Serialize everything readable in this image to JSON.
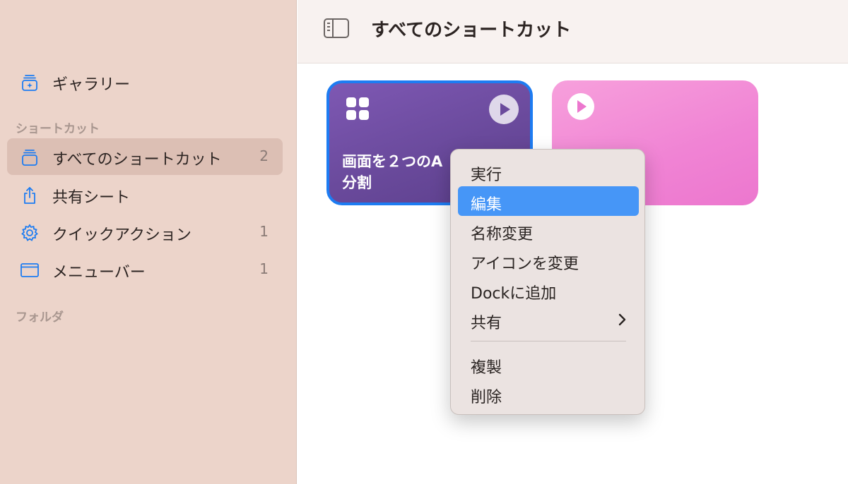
{
  "sidebar": {
    "gallery_label": "ギャラリー",
    "section_shortcuts": "ショートカット",
    "items": [
      {
        "label": "すべてのショートカット",
        "count": "2",
        "icon": "stack-icon"
      },
      {
        "label": "共有シート",
        "count": "",
        "icon": "share-icon"
      },
      {
        "label": "クイックアクション",
        "count": "1",
        "icon": "gear-icon"
      },
      {
        "label": "メニューバー",
        "count": "1",
        "icon": "window-icon"
      }
    ],
    "section_folders": "フォルダ"
  },
  "header": {
    "title": "すべてのショートカット",
    "toggle_icon": "sidebar-toggle-icon"
  },
  "cards": [
    {
      "title": "画面を２つのA\n分割",
      "color": "#6a4a9c",
      "selected": true
    },
    {
      "title": "",
      "color": "#f083d4",
      "selected": false
    }
  ],
  "context_menu": {
    "items": [
      {
        "label": "実行"
      },
      {
        "label": "編集"
      },
      {
        "label": "名称変更"
      },
      {
        "label": "アイコンを変更"
      },
      {
        "label": "Dockに追加"
      },
      {
        "label": "共有"
      },
      {
        "label": "複製"
      },
      {
        "label": "削除"
      }
    ]
  },
  "colors": {
    "sidebar_bg": "#ecd4ca",
    "accent_blue": "#1d7cf2",
    "menu_highlight": "#4696f7"
  }
}
